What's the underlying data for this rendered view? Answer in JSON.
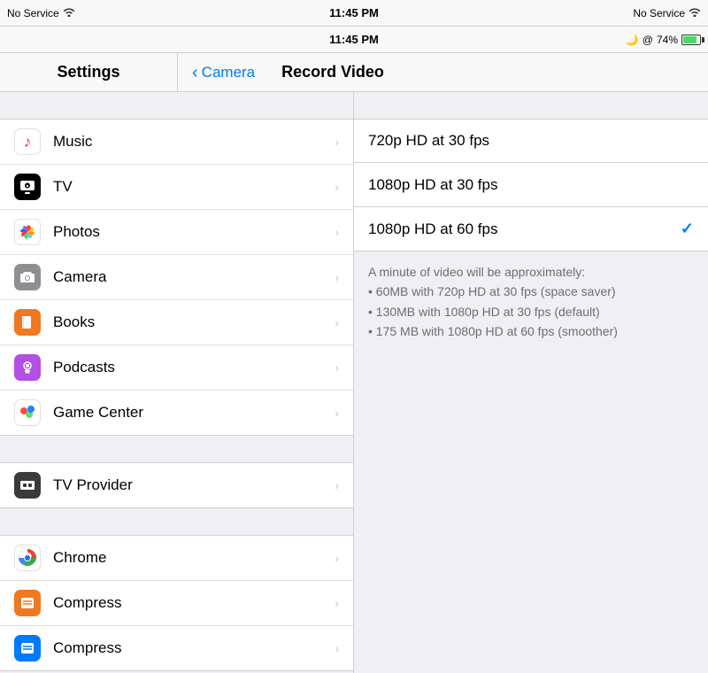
{
  "statusBar": {
    "leftNoService": "No Service",
    "leftWifi": "wifi",
    "centerTime": "11:45 PM",
    "rightMoon": "🌙",
    "rightAt": "@",
    "rightBattery": "74%",
    "rightNoService": "No Service",
    "rightWifi": "wifi"
  },
  "navHeader": {
    "leftTitle": "Settings",
    "backLabel": "Camera",
    "rightTitle": "Record Video"
  },
  "settingsItems": [
    {
      "id": "music",
      "label": "Music",
      "iconType": "music"
    },
    {
      "id": "tv",
      "label": "TV",
      "iconType": "tv"
    },
    {
      "id": "photos",
      "label": "Photos",
      "iconType": "photos"
    },
    {
      "id": "camera",
      "label": "Camera",
      "iconType": "camera"
    },
    {
      "id": "books",
      "label": "Books",
      "iconType": "books"
    },
    {
      "id": "podcasts",
      "label": "Podcasts",
      "iconType": "podcasts"
    },
    {
      "id": "gamecenter",
      "label": "Game Center",
      "iconType": "gamecenter"
    }
  ],
  "settingsItems2": [
    {
      "id": "tvprovider",
      "label": "TV Provider",
      "iconType": "tvprovider"
    }
  ],
  "settingsItems3": [
    {
      "id": "chrome",
      "label": "Chrome",
      "iconType": "chrome"
    },
    {
      "id": "compress1",
      "label": "Compress",
      "iconType": "compress1"
    },
    {
      "id": "compress2",
      "label": "Compress",
      "iconType": "compress2"
    }
  ],
  "videoOptions": [
    {
      "id": "720p30",
      "label": "720p HD at 30 fps",
      "selected": false
    },
    {
      "id": "1080p30",
      "label": "1080p HD at 30 fps",
      "selected": false
    },
    {
      "id": "1080p60",
      "label": "1080p HD at 60 fps",
      "selected": true
    }
  ],
  "videoInfo": {
    "title": "A minute of video will be approximately:",
    "bullet1": "• 60MB with 720p HD at 30 fps (space saver)",
    "bullet2": "• 130MB with 1080p HD at 30 fps (default)",
    "bullet3": "• 175 MB with 1080p HD at 60 fps (smoother)"
  }
}
